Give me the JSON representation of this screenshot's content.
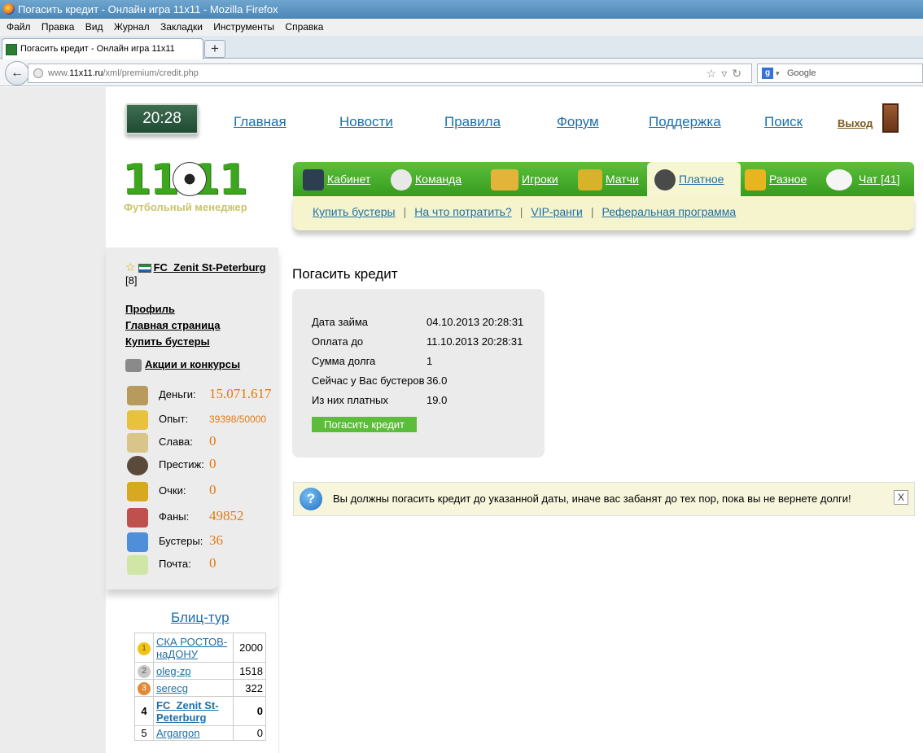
{
  "window": {
    "title": "Погасить кредит - Онлайн игра 11х11 - Mozilla Firefox"
  },
  "menubar": [
    "Файл",
    "Правка",
    "Вид",
    "Журнал",
    "Закладки",
    "Инструменты",
    "Справка"
  ],
  "tab": {
    "title": "Погасить кредит - Онлайн игра 11х11",
    "new_tab": "+"
  },
  "address": {
    "prefix": "www.",
    "domain": "11x11.ru",
    "path": "/xml/premium/credit.php",
    "search_placeholder": "Google"
  },
  "clock": "20:28",
  "topnav": [
    "Главная",
    "Новости",
    "Правила",
    "Форум",
    "Поддержка",
    "Поиск"
  ],
  "logout": "Выход",
  "logo": {
    "digits": "11  11",
    "subtitle": "Футбольный менеджер"
  },
  "greenmenu": [
    "Кабинет",
    "Команда",
    "Игроки",
    "Матчи",
    "Платное",
    "Разное",
    "Чат [41]"
  ],
  "submenu": [
    "Купить бустеры",
    "На что потратить?",
    "VIP-ранги",
    "Реферальная программа"
  ],
  "team": {
    "name": "FC_Zenit St-Peterburg",
    "level": "[8]"
  },
  "sidelinks": [
    "Профиль",
    "Главная страница",
    "Купить бустеры"
  ],
  "promo": "Акции и конкурсы",
  "stats": [
    {
      "label": "Деньги:",
      "value": "15.071.617"
    },
    {
      "label": "Опыт:",
      "value": "39398/50000"
    },
    {
      "label": "Слава:",
      "value": "0"
    },
    {
      "label": "Престиж:",
      "value": "0"
    },
    {
      "label": "Очки:",
      "value": "0"
    },
    {
      "label": "Фаны:",
      "value": "49852"
    },
    {
      "label": "Бустеры:",
      "value": "36"
    },
    {
      "label": "Почта:",
      "value": "0"
    }
  ],
  "blitz": {
    "title": "Блиц-тур",
    "rows": [
      {
        "pos": "1",
        "name": "СКА РОСТОВ-наДОНУ",
        "score": "2000"
      },
      {
        "pos": "2",
        "name": "oleg-zp",
        "score": "1518"
      },
      {
        "pos": "3",
        "name": "serecg",
        "score": "322"
      },
      {
        "pos": "4",
        "name": "FC_Zenit St-Peterburg",
        "score": "0"
      },
      {
        "pos": "5",
        "name": "Argargon",
        "score": "0"
      }
    ]
  },
  "credit": {
    "heading": "Погасить кредит",
    "rows": [
      {
        "label": "Дата займа",
        "value": "04.10.2013 20:28:31"
      },
      {
        "label": "Оплата до",
        "value": "11.10.2013 20:28:31"
      },
      {
        "label": "Сумма долга",
        "value": "1"
      },
      {
        "label": "Сейчас у Вас бустеров",
        "value": "36.0"
      },
      {
        "label": "Из них платных",
        "value": "19.0"
      }
    ],
    "button": "Погасить кредит"
  },
  "notice": {
    "icon": "?",
    "text": "Вы должны погасить кредит до указанной даты, иначе вас забанят до тех пор, пока вы не вернете долги!",
    "close": "X"
  },
  "colors": {
    "green_menu": "#3fa823",
    "accent_orange": "#e07a12",
    "link": "#1e6fa8",
    "yellow_bg": "#f5f4cc"
  }
}
